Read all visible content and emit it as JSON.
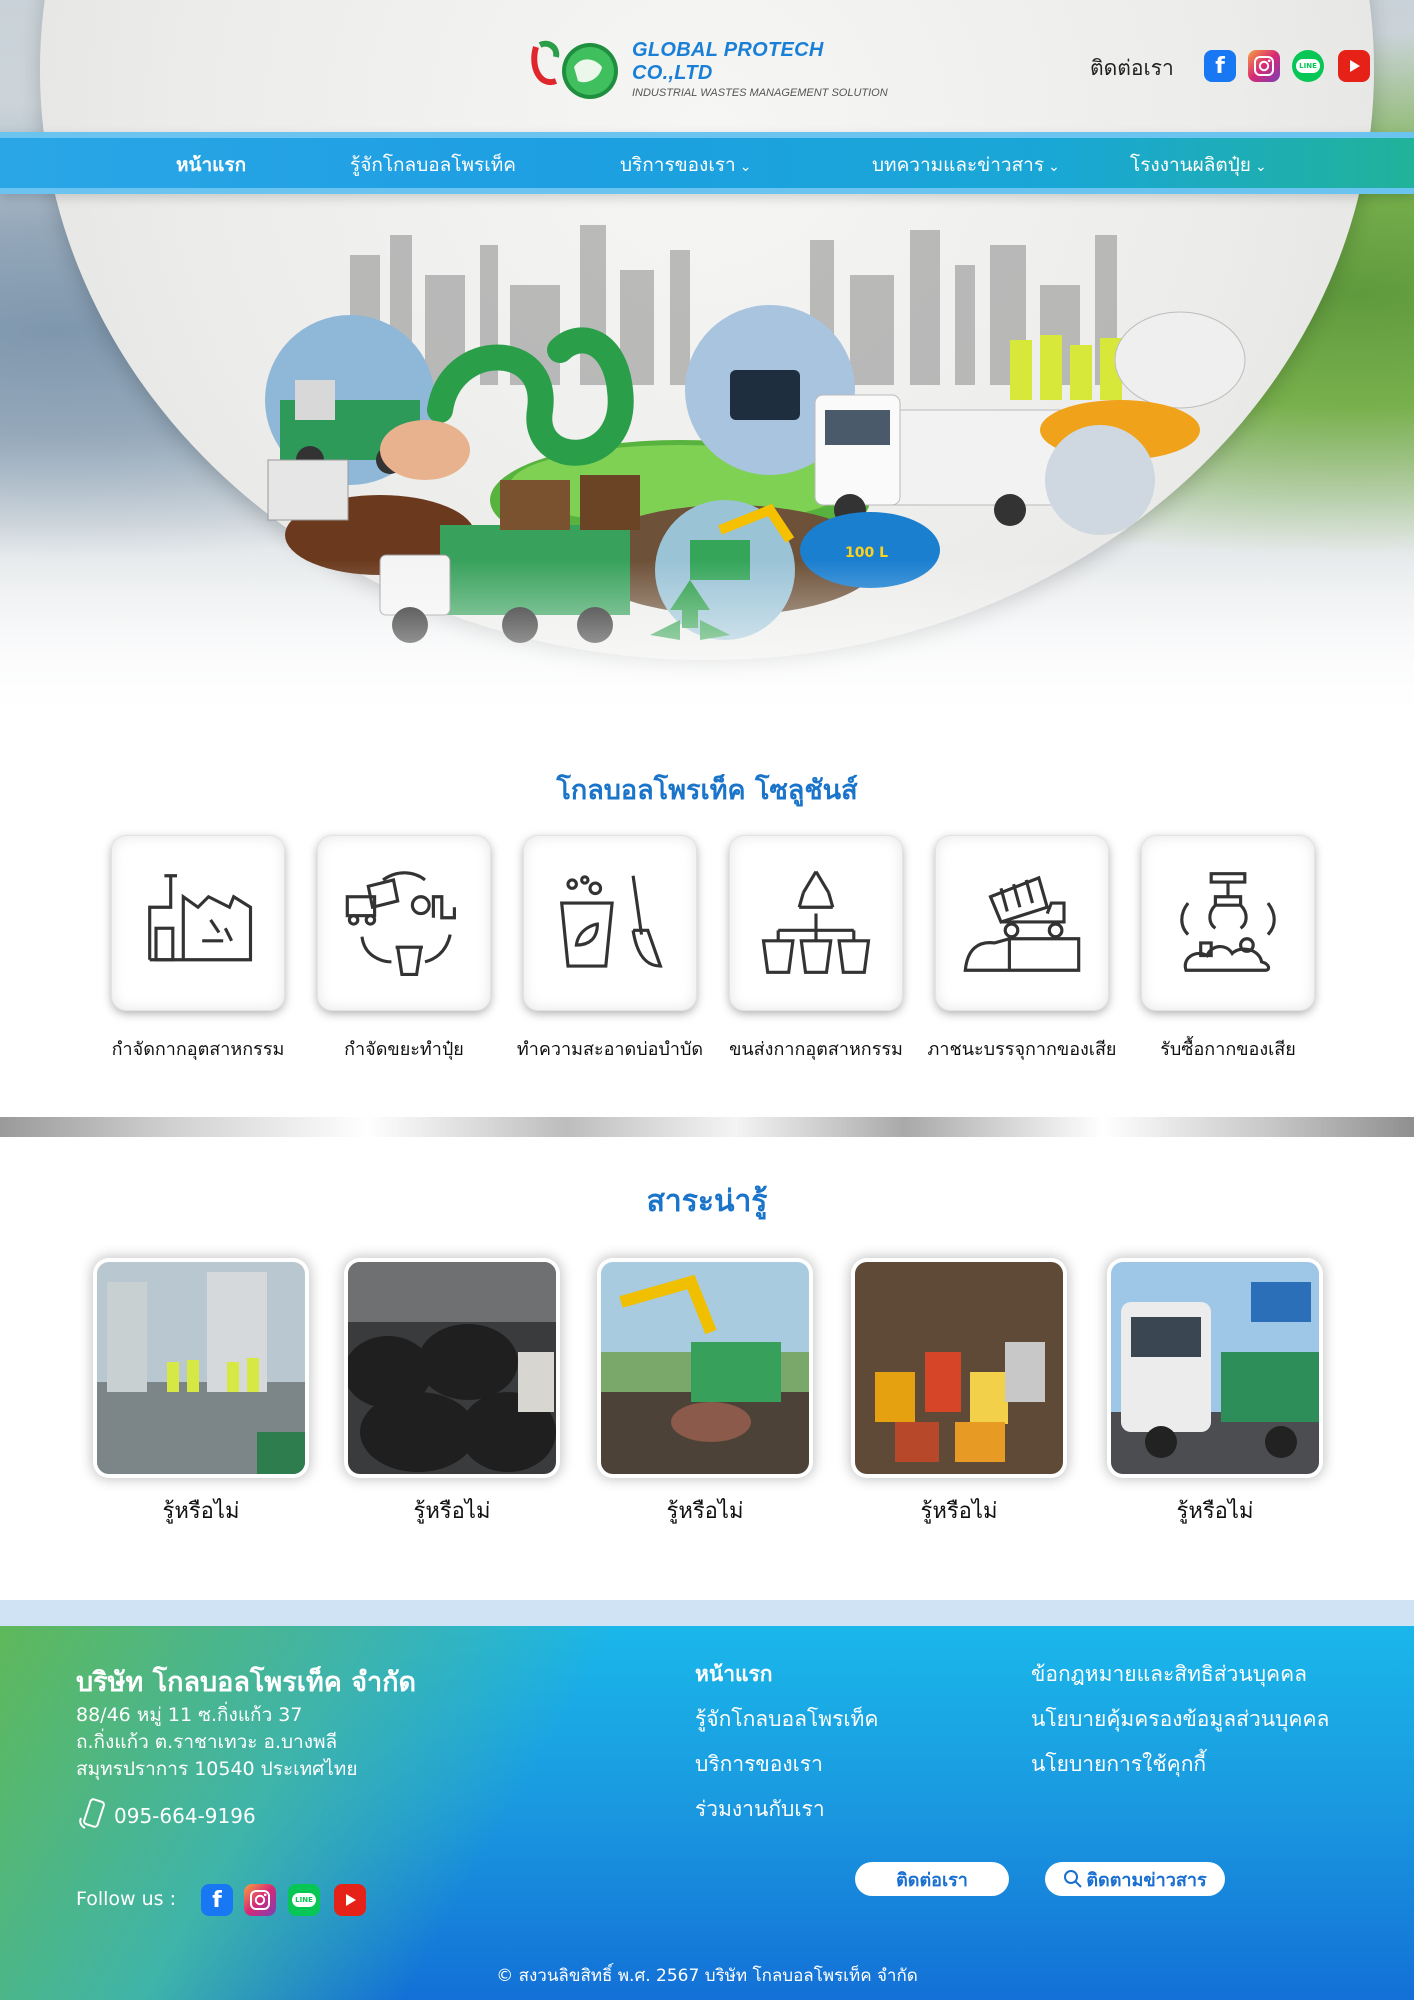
{
  "brand": {
    "name": "GLOBAL PROTECH CO.,LTD",
    "tagline": "INDUSTRIAL WASTES MANAGEMENT SOLUTION"
  },
  "header": {
    "contact_label": "ติดต่อเรา",
    "social": [
      {
        "icon": "facebook-icon",
        "text": "f"
      },
      {
        "icon": "instagram-icon",
        "text": ""
      },
      {
        "icon": "line-icon",
        "text": "LINE"
      },
      {
        "icon": "youtube-icon",
        "text": ""
      }
    ]
  },
  "nav": [
    {
      "label": "หน้าแรก",
      "active": true,
      "dropdown": false
    },
    {
      "label": "รู้จักโกลบอลโพรเท็ค",
      "active": false,
      "dropdown": false
    },
    {
      "label": "บริการของเรา",
      "active": false,
      "dropdown": true
    },
    {
      "label": "บทความและข่าวสาร",
      "active": false,
      "dropdown": true
    },
    {
      "label": "โรงงานผลิตปุ๋ย",
      "active": false,
      "dropdown": true
    }
  ],
  "hero": {
    "tank_label": "100 L"
  },
  "solutions": {
    "title": "โกลบอลโพรเท็ค โซลูชันส์",
    "items": [
      {
        "label": "กำจัดกากอุตสาหกรรม",
        "icon": "factory-recycle-icon"
      },
      {
        "label": "กำจัดขยะทำปุ๋ย",
        "icon": "waste-cycle-icon"
      },
      {
        "label": "ทำความสะอาดบ่อบำบัด",
        "icon": "cleaning-bucket-icon"
      },
      {
        "label": "ขนส่งกากอุตสาหกรรม",
        "icon": "recycle-bins-icon"
      },
      {
        "label": "ภาชนะบรรจุกากของเสีย",
        "icon": "dump-truck-icon"
      },
      {
        "label": "รับซื้อกากของเสีย",
        "icon": "claw-waste-icon"
      }
    ]
  },
  "knowledge": {
    "title": "สาระน่ารู้",
    "items": [
      {
        "label": "รู้หรือไม่"
      },
      {
        "label": "รู้หรือไม่"
      },
      {
        "label": "รู้หรือไม่"
      },
      {
        "label": "รู้หรือไม่"
      },
      {
        "label": "รู้หรือไม่"
      }
    ]
  },
  "footer": {
    "company": "บริษัท โกลบอลโพรเท็ค จำกัด",
    "address": [
      "88/46 หมู่ 11 ซ.กิ่งแก้ว 37",
      "ถ.กิ่งแก้ว ต.ราชาเทวะ อ.บางพลี",
      "สมุทรปราการ 10540 ประเทศไทย"
    ],
    "phone": "095-664-9196",
    "follow": "Follow us :",
    "links_col1": [
      "หน้าแรก",
      "รู้จักโกลบอลโพรเท็ค",
      "บริการของเรา",
      "ร่วมงานกับเรา"
    ],
    "links_col2": [
      "ข้อกฎหมายและสิทธิส่วนบุคคล",
      "นโยบายคุ้มครองข้อมูลส่วนบุคคล",
      "นโยบายการใช้คุกกี้"
    ],
    "contact_button": "ติดต่อเรา",
    "news_button": "ติดตามข่าวสาร",
    "copyright": "© สงวนลิขสิทธิ์ พ.ศ. 2567 บริษัท โกลบอลโพรเท็ค จำกัด"
  },
  "colors": {
    "accent": "#1a74c9",
    "nav": "#1d9fe2",
    "footer_top": "#1ab7ea",
    "footer_bottom": "#1370d6"
  }
}
